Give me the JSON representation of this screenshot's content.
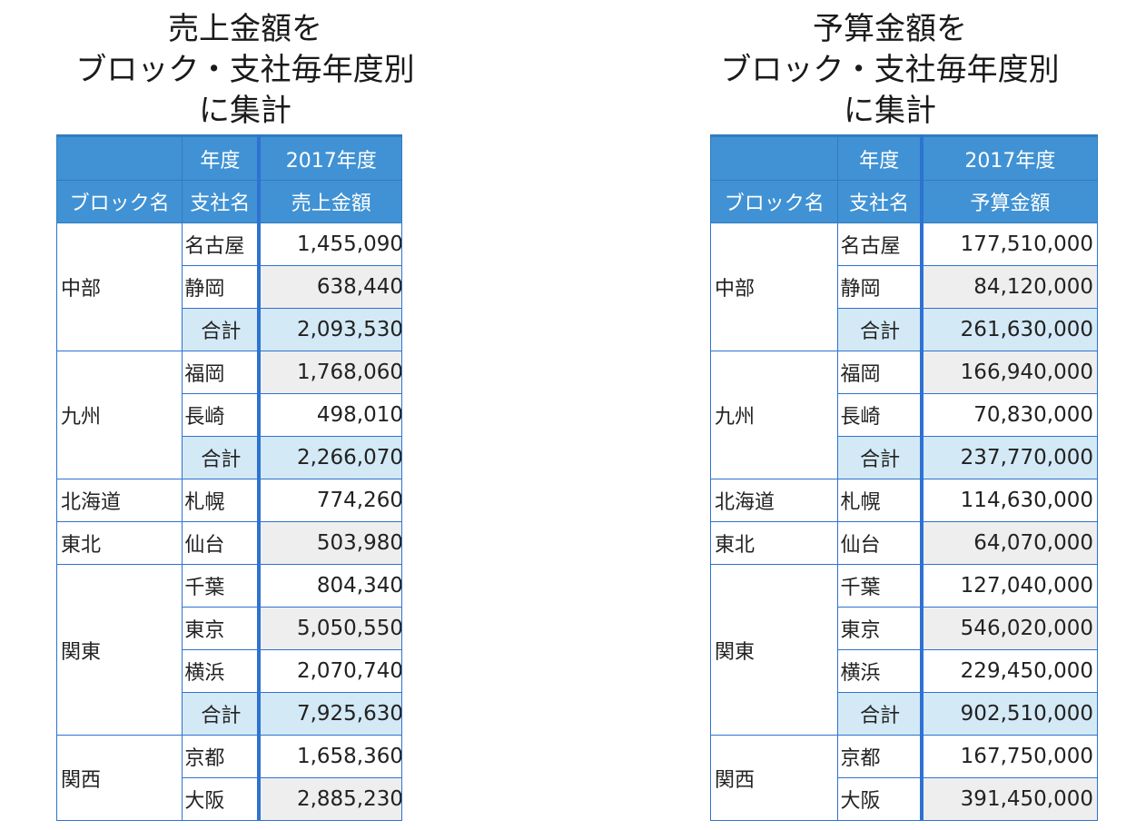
{
  "left": {
    "caption": [
      "売上金額を",
      "ブロック・支社毎年度別",
      "に集計"
    ],
    "header": {
      "year_label": "年度",
      "year": "2017年度",
      "block_col": "ブロック名",
      "branch_col": "支社名",
      "value_col": "売上金額"
    },
    "rows": [
      {
        "block": "中部",
        "branch": "名古屋",
        "value": "1,455,090"
      },
      {
        "branch": "静岡",
        "value": "638,440"
      },
      {
        "branch": "合計",
        "value": "2,093,530"
      },
      {
        "block": "九州",
        "branch": "福岡",
        "value": "1,768,060"
      },
      {
        "branch": "長崎",
        "value": "498,010"
      },
      {
        "branch": "合計",
        "value": "2,266,070"
      },
      {
        "block": "北海道",
        "branch": "札幌",
        "value": "774,260"
      },
      {
        "block": "東北",
        "branch": "仙台",
        "value": "503,980"
      },
      {
        "block": "関東",
        "branch": "千葉",
        "value": "804,340"
      },
      {
        "branch": "東京",
        "value": "5,050,550"
      },
      {
        "branch": "横浜",
        "value": "2,070,740"
      },
      {
        "branch": "合計",
        "value": "7,925,630"
      },
      {
        "block": "関西",
        "branch": "京都",
        "value": "1,658,360"
      },
      {
        "branch": "大阪",
        "value": "2,885,230"
      }
    ]
  },
  "right": {
    "caption": [
      "予算金額を",
      "ブロック・支社毎年度別",
      "に集計"
    ],
    "header": {
      "year_label": "年度",
      "year": "2017年度",
      "block_col": "ブロック名",
      "branch_col": "支社名",
      "value_col": "予算金額"
    },
    "rows": [
      {
        "block": "中部",
        "branch": "名古屋",
        "value": "177,510,000"
      },
      {
        "branch": "静岡",
        "value": "84,120,000"
      },
      {
        "branch": "合計",
        "value": "261,630,000"
      },
      {
        "block": "九州",
        "branch": "福岡",
        "value": "166,940,000"
      },
      {
        "branch": "長崎",
        "value": "70,830,000"
      },
      {
        "branch": "合計",
        "value": "237,770,000"
      },
      {
        "block": "北海道",
        "branch": "札幌",
        "value": "114,630,000"
      },
      {
        "block": "東北",
        "branch": "仙台",
        "value": "64,070,000"
      },
      {
        "block": "関東",
        "branch": "千葉",
        "value": "127,040,000"
      },
      {
        "branch": "東京",
        "value": "546,020,000"
      },
      {
        "branch": "横浜",
        "value": "229,450,000"
      },
      {
        "branch": "合計",
        "value": "902,510,000"
      },
      {
        "block": "関西",
        "branch": "京都",
        "value": "167,750,000"
      },
      {
        "branch": "大阪",
        "value": "391,450,000"
      }
    ]
  }
}
